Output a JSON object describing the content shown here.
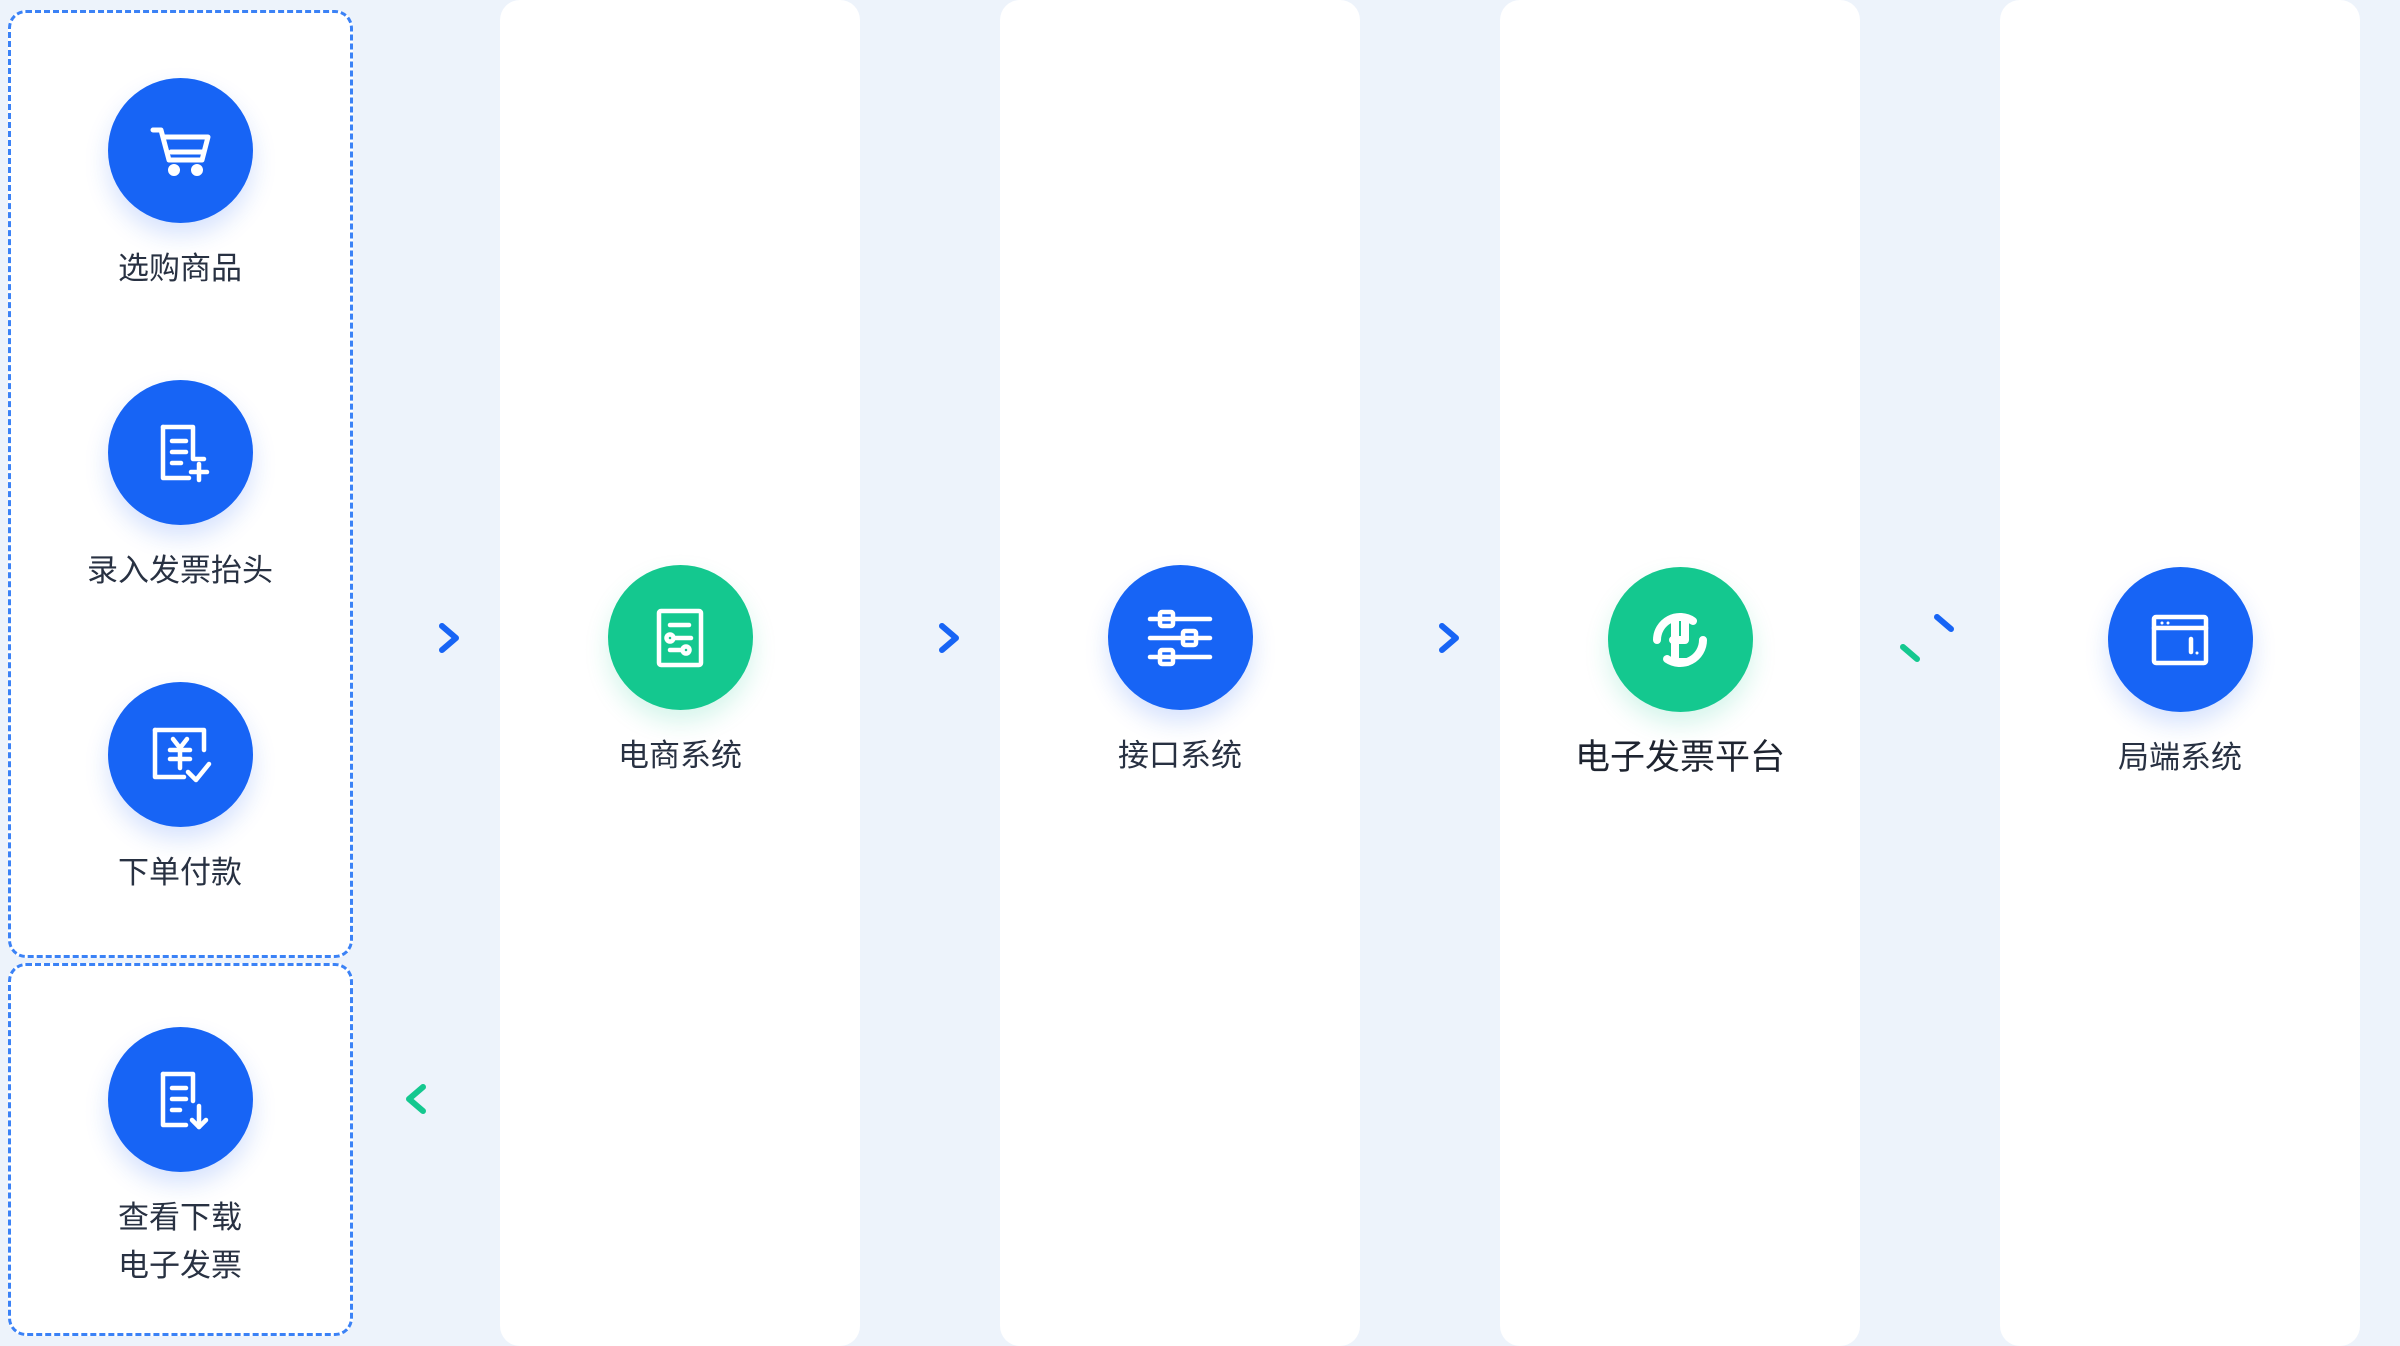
{
  "diagram": {
    "colors": {
      "background": "#edf3fb",
      "panel": "#ffffff",
      "primary_blue": "#1764f5",
      "accent_green": "#14c88f",
      "dashed_border": "#3b82f6"
    },
    "user_actions": {
      "items": [
        {
          "label": "选购商品",
          "icon": "shopping-cart-icon"
        },
        {
          "label": "录入发票抬头",
          "icon": "document-add-icon"
        },
        {
          "label": "下单付款",
          "icon": "payment-check-icon"
        }
      ]
    },
    "result": {
      "label": "查看下载\n电子发票",
      "icon": "document-download-icon"
    },
    "systems": [
      {
        "label": "电商系统",
        "icon": "document-list-icon",
        "color": "green"
      },
      {
        "label": "接口系统",
        "icon": "settings-sliders-icon",
        "color": "blue"
      },
      {
        "label": "电子发票平台",
        "icon": "platform-logo-icon",
        "color": "green"
      },
      {
        "label": "局端系统",
        "icon": "window-terminal-icon",
        "color": "blue"
      }
    ],
    "connectors": {
      "forward": "right-arrow-icon",
      "return": "left-arrow-icon",
      "exchange": "exchange-arrows-icon"
    }
  }
}
